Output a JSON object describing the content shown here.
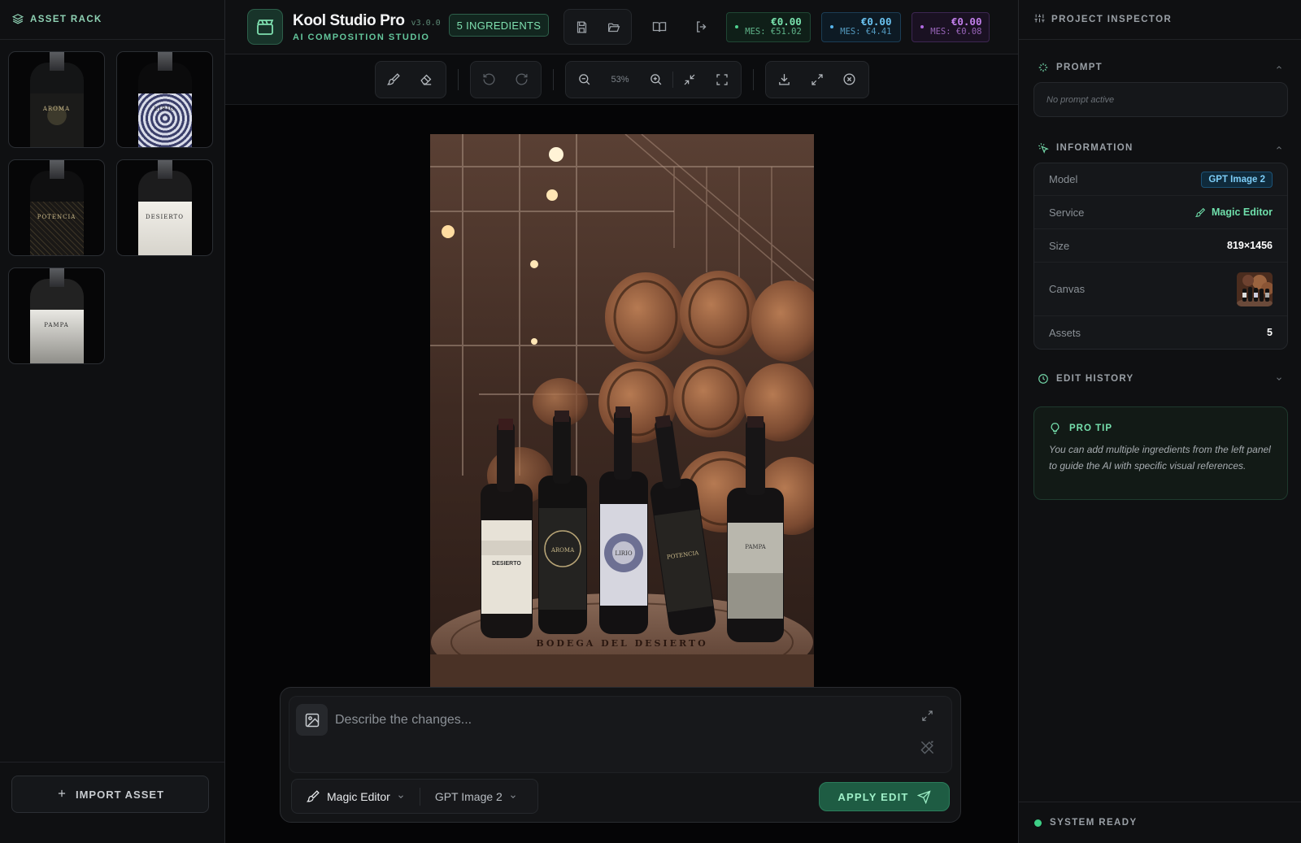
{
  "left_panel": {
    "title": "ASSET RACK",
    "assets": [
      {
        "label": "AROMA"
      },
      {
        "label": "LIRIO"
      },
      {
        "label": "POTENCIA"
      },
      {
        "label": "DESIERTO"
      },
      {
        "label": "PAMPA"
      }
    ],
    "import_label": "IMPORT ASSET"
  },
  "header": {
    "app_title": "Kool Studio Pro",
    "version": "v3.0.0",
    "subtitle": "AI COMPOSITION STUDIO",
    "ingredients_badge": "5 INGREDIENTS",
    "costs": [
      {
        "main": "€0.00",
        "sub": "MES: €51.02",
        "color": "#79e3ae"
      },
      {
        "main": "€0.00",
        "sub": "MES: €4.41",
        "color": "#6ac2f0"
      },
      {
        "main": "€0.00",
        "sub": "MES: €0.08",
        "color": "#c17fea"
      }
    ]
  },
  "toolbar": {
    "zoom_level": "53%"
  },
  "canvas": {
    "barrel_text": "BODEGA DEL DESIERTO",
    "bottles": [
      "DESIERTO",
      "AROMA",
      "LIRIO",
      "POTENCIA",
      "PAMPA"
    ]
  },
  "prompt_bar": {
    "placeholder": "Describe the changes...",
    "service_label": "Magic Editor",
    "model_label": "GPT Image 2",
    "apply_label": "APPLY EDIT"
  },
  "inspector": {
    "title": "PROJECT INSPECTOR",
    "prompt_section": "PROMPT",
    "prompt_empty": "No prompt active",
    "info_section": "INFORMATION",
    "info": {
      "model_key": "Model",
      "model_val": "GPT Image 2",
      "service_key": "Service",
      "service_val": "Magic Editor",
      "size_key": "Size",
      "size_val": "819×1456",
      "canvas_key": "Canvas",
      "assets_key": "Assets",
      "assets_val": "5"
    },
    "history_section": "EDIT HISTORY",
    "tip_title": "PRO TIP",
    "tip_text": "You can add multiple ingredients from the left panel to guide the AI with specific visual references."
  },
  "status": {
    "text": "SYSTEM READY",
    "color": "#3ecf86"
  }
}
